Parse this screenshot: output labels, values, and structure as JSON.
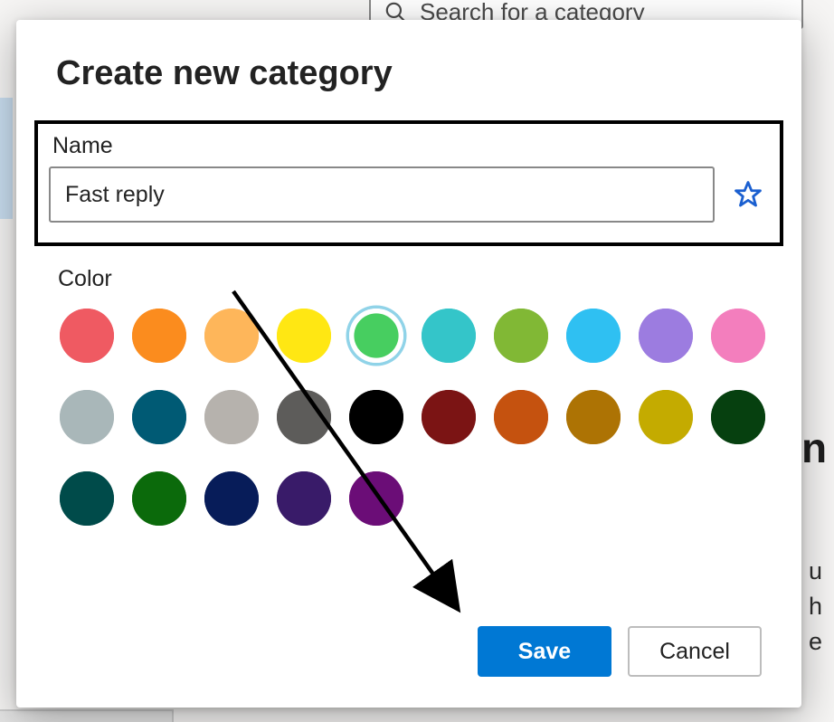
{
  "background": {
    "search_placeholder": "Search for a category",
    "right_frag_lines": "u\nh\ne"
  },
  "dialog": {
    "title": "Create new category",
    "name": {
      "label": "Name",
      "value": "Fast reply"
    },
    "favorite_star": {
      "active": false
    },
    "color": {
      "label": "Color",
      "selected_index": 4,
      "swatches": [
        {
          "name": "red",
          "hex": "#ef5a62"
        },
        {
          "name": "orange",
          "hex": "#fb8c1e"
        },
        {
          "name": "peach",
          "hex": "#feb65a"
        },
        {
          "name": "yellow",
          "hex": "#ffe713"
        },
        {
          "name": "light-green",
          "hex": "#47ce60"
        },
        {
          "name": "teal",
          "hex": "#34c5c9"
        },
        {
          "name": "olive",
          "hex": "#81b835"
        },
        {
          "name": "sky-blue",
          "hex": "#2fc0f2"
        },
        {
          "name": "lavender",
          "hex": "#9c7ce0"
        },
        {
          "name": "pink",
          "hex": "#f37ebd"
        },
        {
          "name": "steel",
          "hex": "#a9b7b9"
        },
        {
          "name": "dark-teal",
          "hex": "#005a74"
        },
        {
          "name": "gray",
          "hex": "#b6b2ad"
        },
        {
          "name": "dark-gray",
          "hex": "#5d5c5a"
        },
        {
          "name": "black",
          "hex": "#000000"
        },
        {
          "name": "dark-red",
          "hex": "#7b1414"
        },
        {
          "name": "dark-orange",
          "hex": "#c5520f"
        },
        {
          "name": "brown",
          "hex": "#ad7304"
        },
        {
          "name": "dark-yellow",
          "hex": "#c4ab00"
        },
        {
          "name": "dark-green",
          "hex": "#06400f"
        },
        {
          "name": "deep-teal",
          "hex": "#004b4a"
        },
        {
          "name": "forest-green",
          "hex": "#0b6a0b"
        },
        {
          "name": "dark-blue",
          "hex": "#071c59"
        },
        {
          "name": "dark-purple",
          "hex": "#391b69"
        },
        {
          "name": "magenta",
          "hex": "#6b0d77"
        }
      ]
    },
    "buttons": {
      "save": "Save",
      "cancel": "Cancel"
    }
  }
}
